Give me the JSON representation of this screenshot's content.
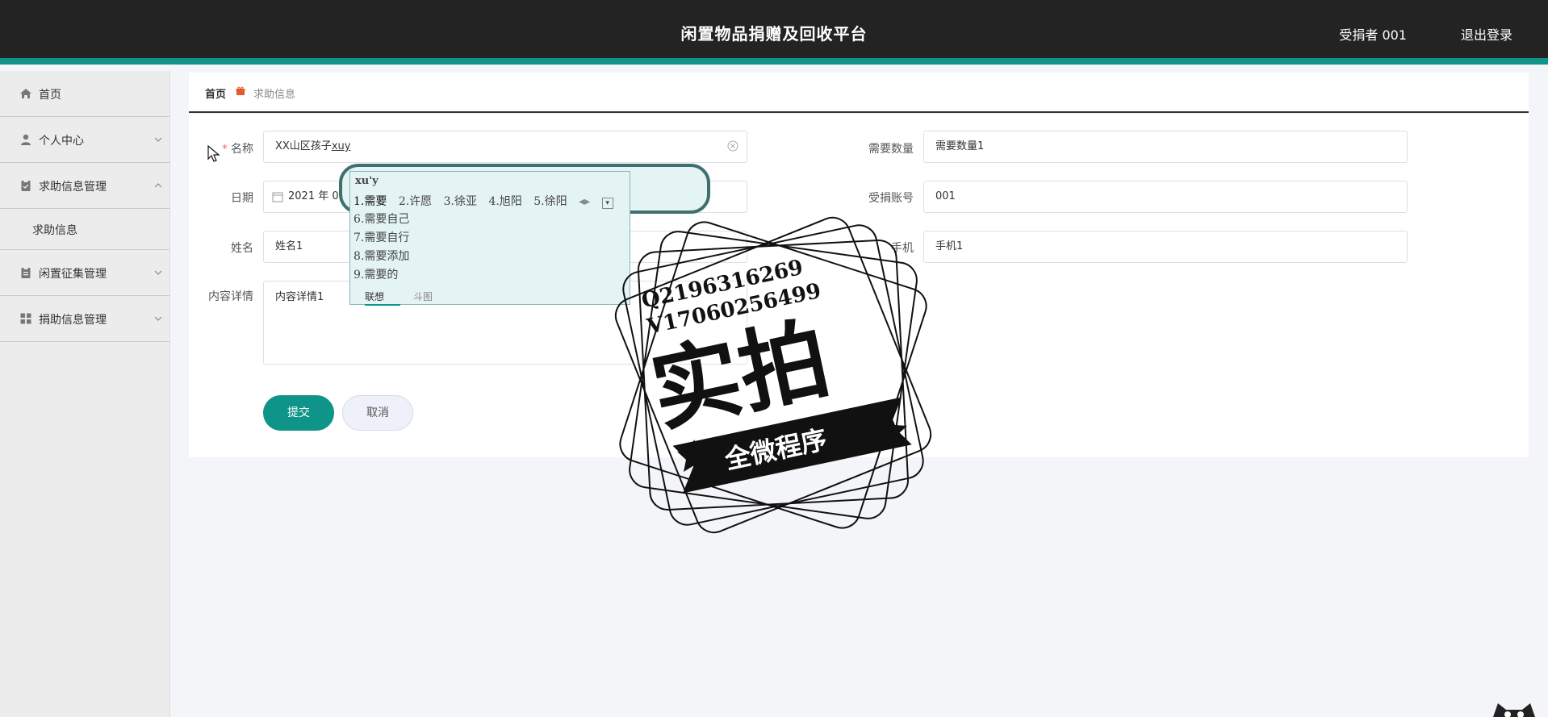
{
  "header": {
    "title": "闲置物品捐赠及回收平台",
    "user": "受捐者 001",
    "logout": "退出登录"
  },
  "sidebar": {
    "items": [
      {
        "label": "首页",
        "icon": "home-icon",
        "expandable": false
      },
      {
        "label": "个人中心",
        "icon": "person-icon",
        "expandable": true,
        "expanded": false
      },
      {
        "label": "求助信息管理",
        "icon": "clipboard-icon",
        "expandable": true,
        "expanded": true,
        "children": [
          {
            "label": "求助信息"
          }
        ]
      },
      {
        "label": "闲置征集管理",
        "icon": "clipboard-icon",
        "expandable": true,
        "expanded": false
      },
      {
        "label": "捐助信息管理",
        "icon": "grid-icon",
        "expandable": true,
        "expanded": false
      }
    ]
  },
  "breadcrumb": {
    "home": "首页",
    "current": "求助信息"
  },
  "form": {
    "name_label": "名称",
    "name_value": "XX山区孩子",
    "name_composing": "xuy",
    "date_label": "日期",
    "date_value": "2021 年 0",
    "person_label": "姓名",
    "person_value": "姓名1",
    "detail_label": "内容详情",
    "detail_value": "内容详情1",
    "qty_label": "需要数量",
    "qty_value": "需要数量1",
    "account_label": "受捐账号",
    "account_value": "001",
    "phone_label": "手机",
    "phone_value": "手机1",
    "submit": "提交",
    "cancel": "取消"
  },
  "ime": {
    "composition": "xu'y",
    "candidates_row": [
      "1.需要",
      "2.许愿",
      "3.徐亚",
      "4.旭阳",
      "5.徐阳"
    ],
    "candidates_more": [
      "6.需要自己",
      "7.需要自行",
      "8.需要添加",
      "9.需要的"
    ],
    "tabs": [
      "联想",
      "斗图"
    ]
  },
  "watermark": {
    "contact1": "Q2196316269",
    "contact2": "V17060256499",
    "big_text": "实拍",
    "banner": "全微程序"
  },
  "colors": {
    "accent": "#0e9488",
    "header_bg": "#232323",
    "sidebar_bg": "#ececec",
    "required": "#f56c6c"
  }
}
